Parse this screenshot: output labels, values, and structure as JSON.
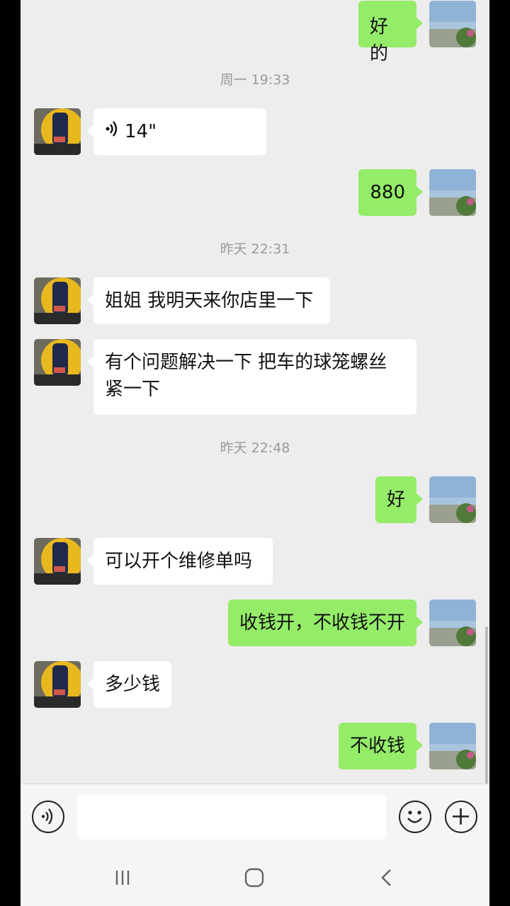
{
  "messages": [
    {
      "dir": "out",
      "text": "好的"
    },
    {
      "timestamp": "周一 19:33"
    },
    {
      "dir": "in",
      "voice": true,
      "text": "14\""
    },
    {
      "dir": "out",
      "text": "880"
    },
    {
      "timestamp": "昨天 22:31"
    },
    {
      "dir": "in",
      "text": "姐姐 我明天来你店里一下"
    },
    {
      "dir": "in",
      "text": "有个问题解决一下 把车的球笼螺丝紧一下"
    },
    {
      "timestamp": "昨天 22:48"
    },
    {
      "dir": "out",
      "text": "好"
    },
    {
      "dir": "in",
      "text": "可以开个维修单吗"
    },
    {
      "dir": "out",
      "text": "收钱开，不收钱不开"
    },
    {
      "dir": "in",
      "text": "多少钱"
    },
    {
      "dir": "out",
      "text": "不收钱"
    }
  ],
  "input": {
    "value": "",
    "placeholder": ""
  },
  "icons": {
    "voice": "voice-input-icon",
    "emoji": "emoji-icon",
    "plus": "plus-icon",
    "recents": "recent-apps-icon",
    "home": "home-icon",
    "back": "back-icon"
  },
  "colors": {
    "outgoing_bubble": "#95ec69",
    "incoming_bubble": "#ffffff",
    "background": "#ededed"
  }
}
